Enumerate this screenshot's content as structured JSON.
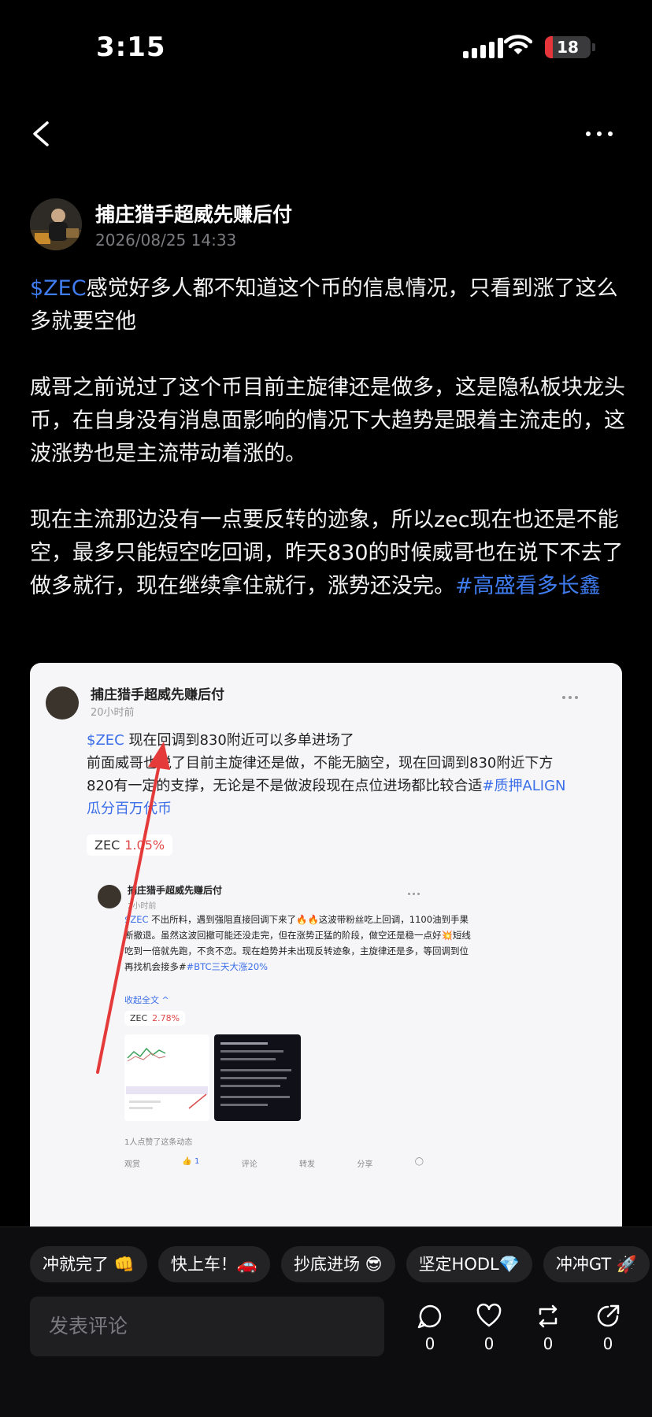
{
  "status_bar": {
    "time": "3:15",
    "battery": "18",
    "battery_level": 0.18
  },
  "nav": {
    "back_icon": "chevron-left-icon",
    "more_icon": "more-horizontal-icon"
  },
  "author": {
    "name": "捕庄猎手超威先赚后付",
    "time": "2026/08/25 14:33"
  },
  "post": {
    "p1_cashtag": "$ZEC",
    "p1_text": "感觉好多人都不知道这个币的信息情况，只看到涨了这么多就要空他",
    "p2_text": "威哥之前说过了这个币目前主旋律还是做多，这是隐私板块龙头币，在自身没有消息面影响的情况下大趋势是跟着主流走的，这波涨势也是主流带动着涨的。",
    "p3_text": "现在主流那边没有一点要反转的迹象，所以zec现在也还是不能空，最多只能短空吃回调，昨天830的时候威哥也在说下不去了做多就行，现在继续拿住就行，涨势还没完。",
    "p3_hashtag": "#高盛看多长鑫"
  },
  "embedded": {
    "name": "捕庄猎手超威先赚后付",
    "time": "20小时前",
    "cashtag": "$ZEC",
    "line1": " 现在回调到830附近可以多单进场了",
    "line2": "前面威哥也说了目前主旋律还是做，不能无脑空，现在回调到830附近下方820有一定的支撑，无论是不是做波段现在点位进场都比较合适",
    "hashtag": "#质押ALIGN瓜分百万代币",
    "chip_ticker": "ZEC",
    "chip_pct": "1.05%",
    "inner": {
      "name": "捕庄猎手超威先赚后付",
      "time": "2小时前",
      "cashtag": "$ZEC",
      "text": " 不出所料，遇到强阻直接回调下来了🔥🔥这波带粉丝吃上回调，1100油到手果断撤退。虽然这波回撤可能还没走完，但在涨势正猛的阶段，做空还是稳一点好💥短线吃到一倍就先跑，不贪不恋。现在趋势并未出现反转迹象，主旋律还是多，等回调到位再找机会接多#",
      "hashtag": "#BTC三天大涨20%",
      "collapse": "收起全文 ^",
      "chip_ticker": "ZEC",
      "chip_pct": "2.78%",
      "liked": "1人点赞了这条动态",
      "actions": [
        "观赏",
        "1",
        "评论",
        "转发",
        "分享"
      ]
    }
  },
  "reactions": [
    "冲就完了 👊",
    "快上车！🚗",
    "抄底进场 😎",
    "坚定HODL💎",
    "冲冲GT 🚀"
  ],
  "comment": {
    "placeholder": "发表评论"
  },
  "actions": {
    "comments": "0",
    "likes": "0",
    "reposts": "0",
    "shares": "0"
  },
  "colors": {
    "link": "#3f7cf0",
    "background": "#000000",
    "up_red": "#e04949"
  }
}
